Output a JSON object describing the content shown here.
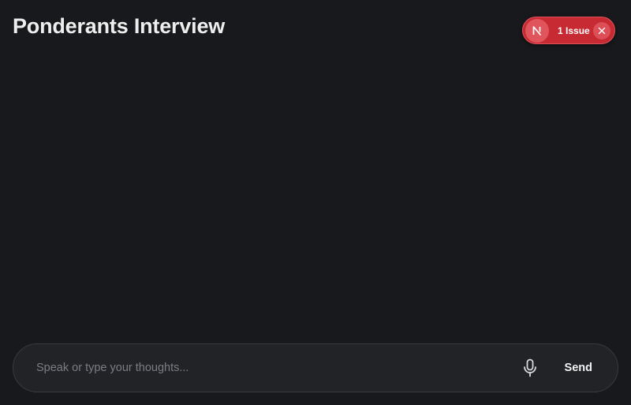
{
  "header": {
    "title": "Ponderants Interview"
  },
  "issue_badge": {
    "logo_letter": "N",
    "label": "1 Issue",
    "logo_icon": "nextjs-logo-icon",
    "close_icon": "close-icon"
  },
  "composer": {
    "value": "",
    "placeholder": "Speak or type your thoughts...",
    "mic_icon": "microphone-icon",
    "send_label": "Send"
  },
  "colors": {
    "background": "#18191c",
    "badge": "#c72a32",
    "composer_bg": "#222327",
    "composer_border": "#3a3b40"
  }
}
